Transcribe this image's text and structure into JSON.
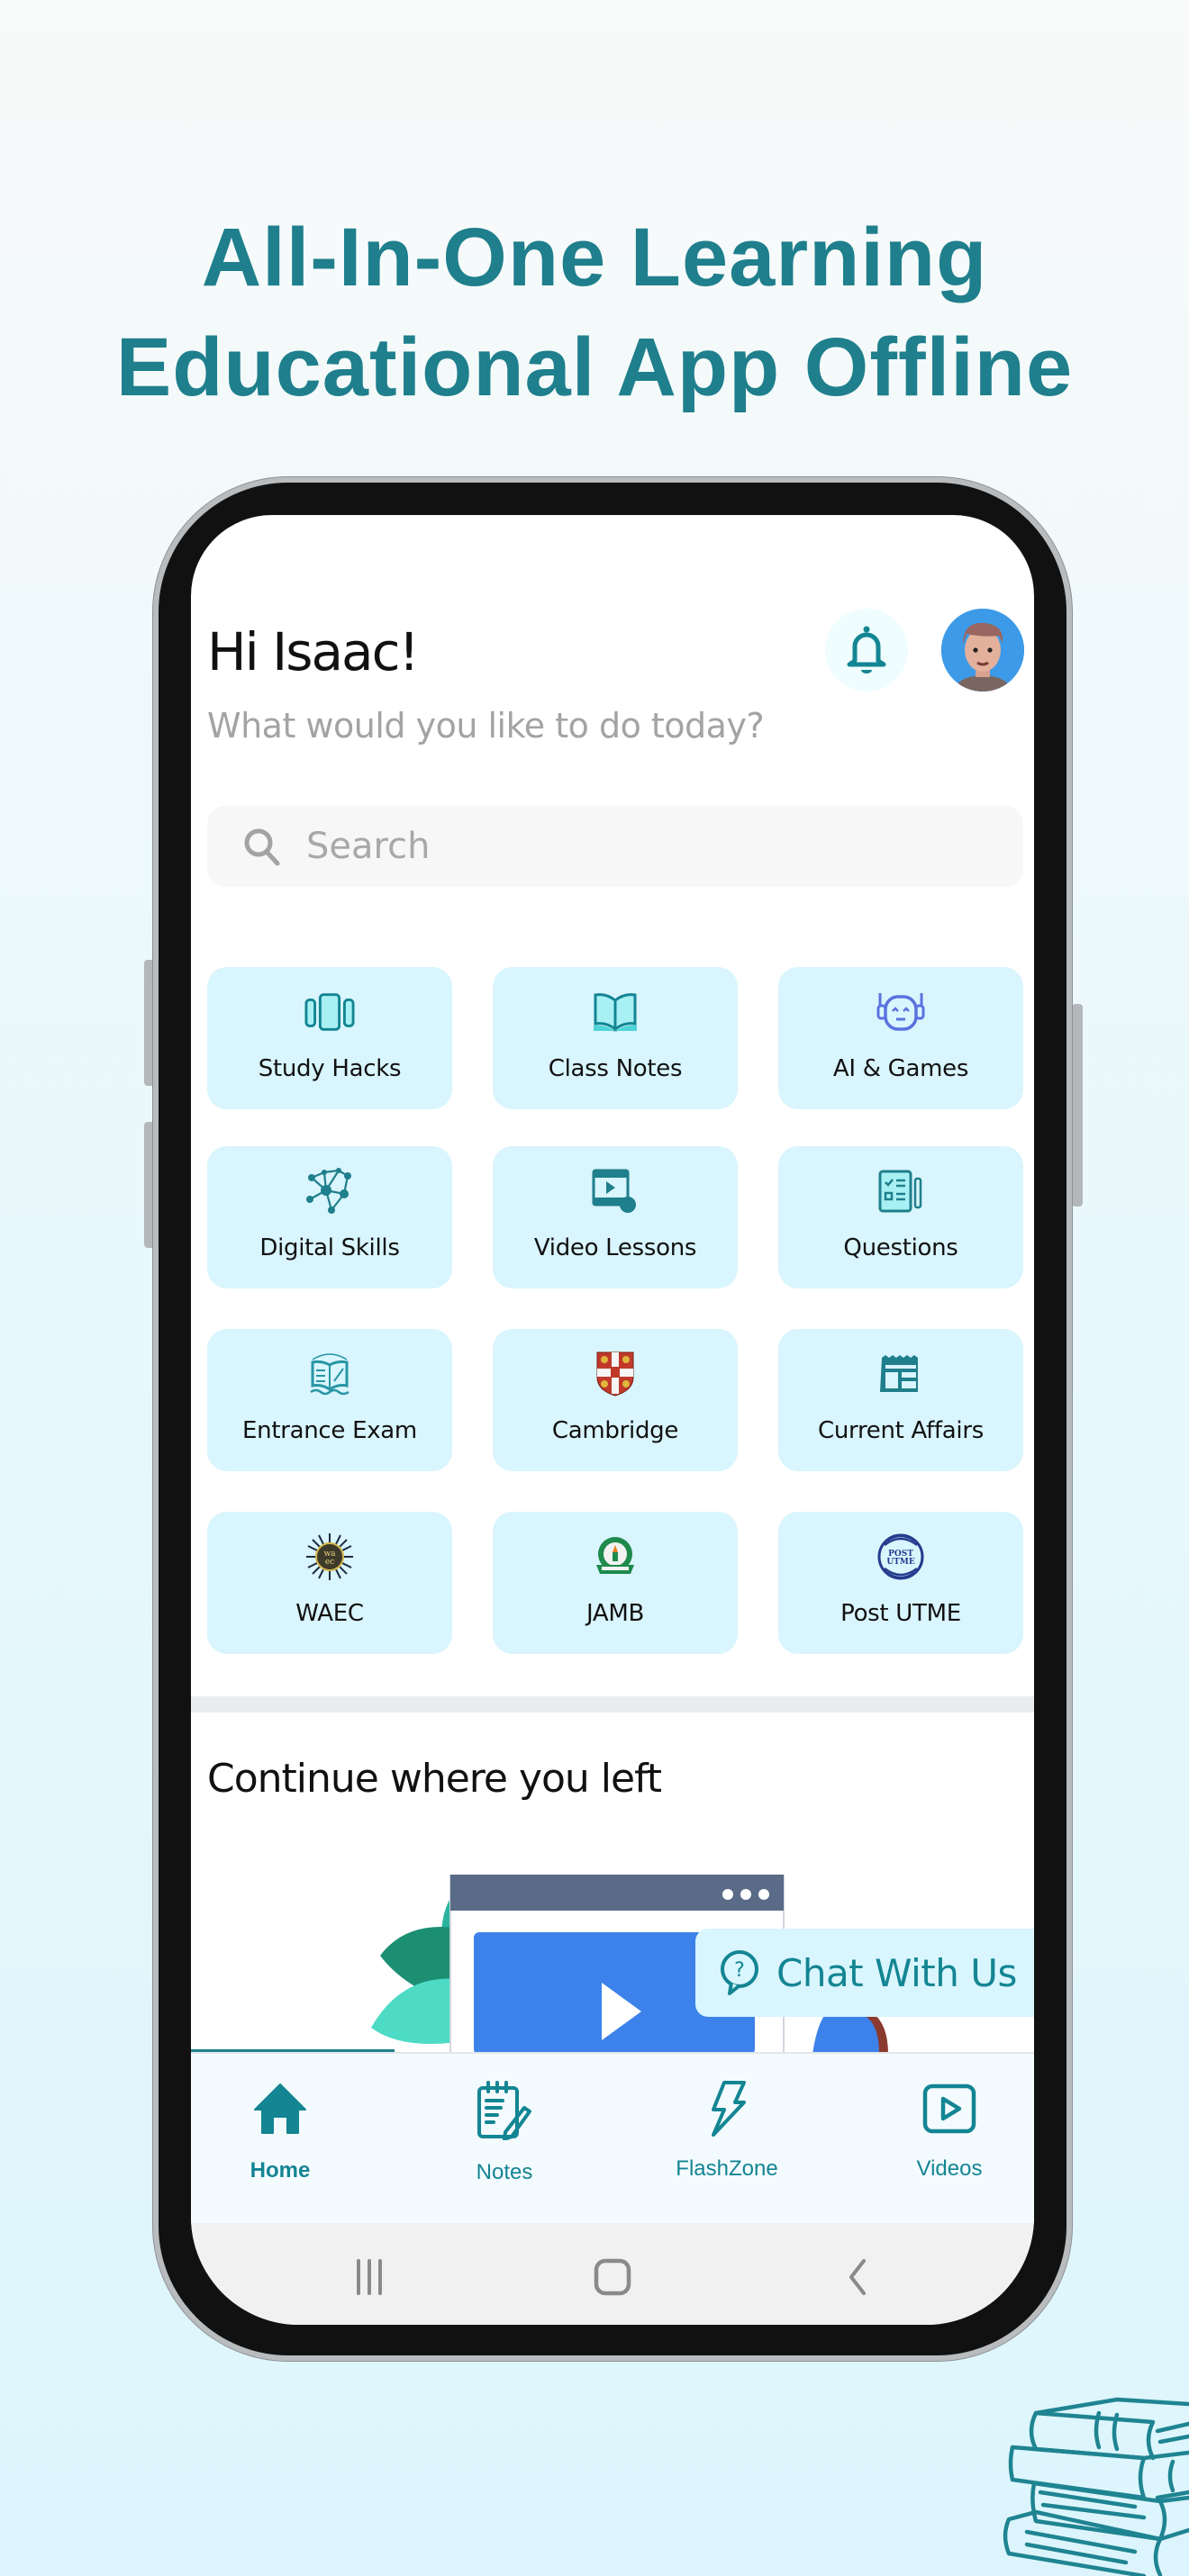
{
  "headline": {
    "line1": "All-In-One Learning",
    "line2": "Educational App Offline"
  },
  "header": {
    "greeting": "Hi Isaac!",
    "subtitle": "What would you like to do today?",
    "notification_icon": "bell-icon",
    "avatar": "user-avatar"
  },
  "search": {
    "placeholder": "Search",
    "value": "",
    "icon": "search-icon"
  },
  "categories": [
    {
      "label": "Study Hacks",
      "icon": "cards-icon"
    },
    {
      "label": "Class Notes",
      "icon": "open-book-icon"
    },
    {
      "label": "AI & Games",
      "icon": "robot-icon"
    },
    {
      "label": "Digital Skills",
      "icon": "network-icon"
    },
    {
      "label": "Video Lessons",
      "icon": "video-tap-icon"
    },
    {
      "label": "Questions",
      "icon": "checklist-icon"
    },
    {
      "label": "Entrance Exam",
      "icon": "entrance-exam-logo"
    },
    {
      "label": "Cambridge",
      "icon": "cambridge-crest"
    },
    {
      "label": "Current Affairs",
      "icon": "newspaper-icon"
    },
    {
      "label": "WAEC",
      "icon": "waec-logo"
    },
    {
      "label": "JAMB",
      "icon": "jamb-logo"
    },
    {
      "label": "Post UTME",
      "icon": "post-utme-logo"
    }
  ],
  "continue_section": {
    "title": "Continue where you left"
  },
  "chat": {
    "label": "Chat With Us",
    "icon": "help-chat-icon"
  },
  "bottom_nav": [
    {
      "label": "Home",
      "icon": "home-icon",
      "active": true
    },
    {
      "label": "Notes",
      "icon": "notes-icon",
      "active": false
    },
    {
      "label": "FlashZone",
      "icon": "lightning-icon",
      "active": false
    },
    {
      "label": "Videos",
      "icon": "play-icon",
      "active": false
    }
  ],
  "system_nav": [
    "recents",
    "home",
    "back"
  ],
  "colors": {
    "brand": "#1f7f8c",
    "accent": "#138593",
    "tile_bg": "#d9f5fd"
  }
}
